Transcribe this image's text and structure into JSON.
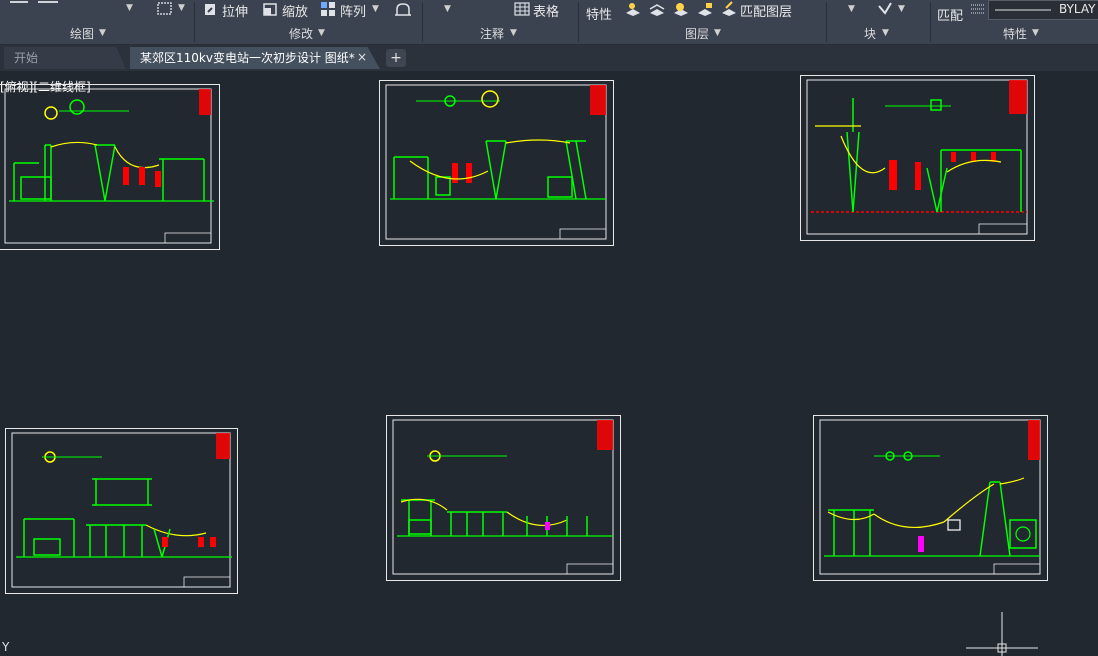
{
  "ribbon": {
    "groups": [
      {
        "id": "draw",
        "label": "绘图"
      },
      {
        "id": "modify",
        "label": "修改"
      },
      {
        "id": "annotate",
        "label": "注释"
      },
      {
        "id": "layers",
        "label": "图层"
      },
      {
        "id": "block",
        "label": "块"
      },
      {
        "id": "properties",
        "label": "特性"
      }
    ],
    "tools": {
      "stretch": "拉伸",
      "scale": "缩放",
      "array": "阵列",
      "table": "表格",
      "layer_properties": "特性",
      "match_layer": "匹配图层",
      "match_properties": "匹配",
      "linetype": "BYLAY"
    }
  },
  "tabs": {
    "start": "开始",
    "drawing": "某郊区110kv变电站一次初步设计 图纸*",
    "close": "×",
    "add": "+"
  },
  "viewport": {
    "label": "[俯视][二维线框]",
    "ucs_axis": "Y"
  },
  "colors": {
    "ribbon_bg": "#3b4350",
    "canvas_bg": "#212830",
    "sheet_border": "#e8e8e8",
    "structure_green": "#00ff00",
    "equipment_red": "#ff0000",
    "conductor_yellow": "#ffff00"
  }
}
